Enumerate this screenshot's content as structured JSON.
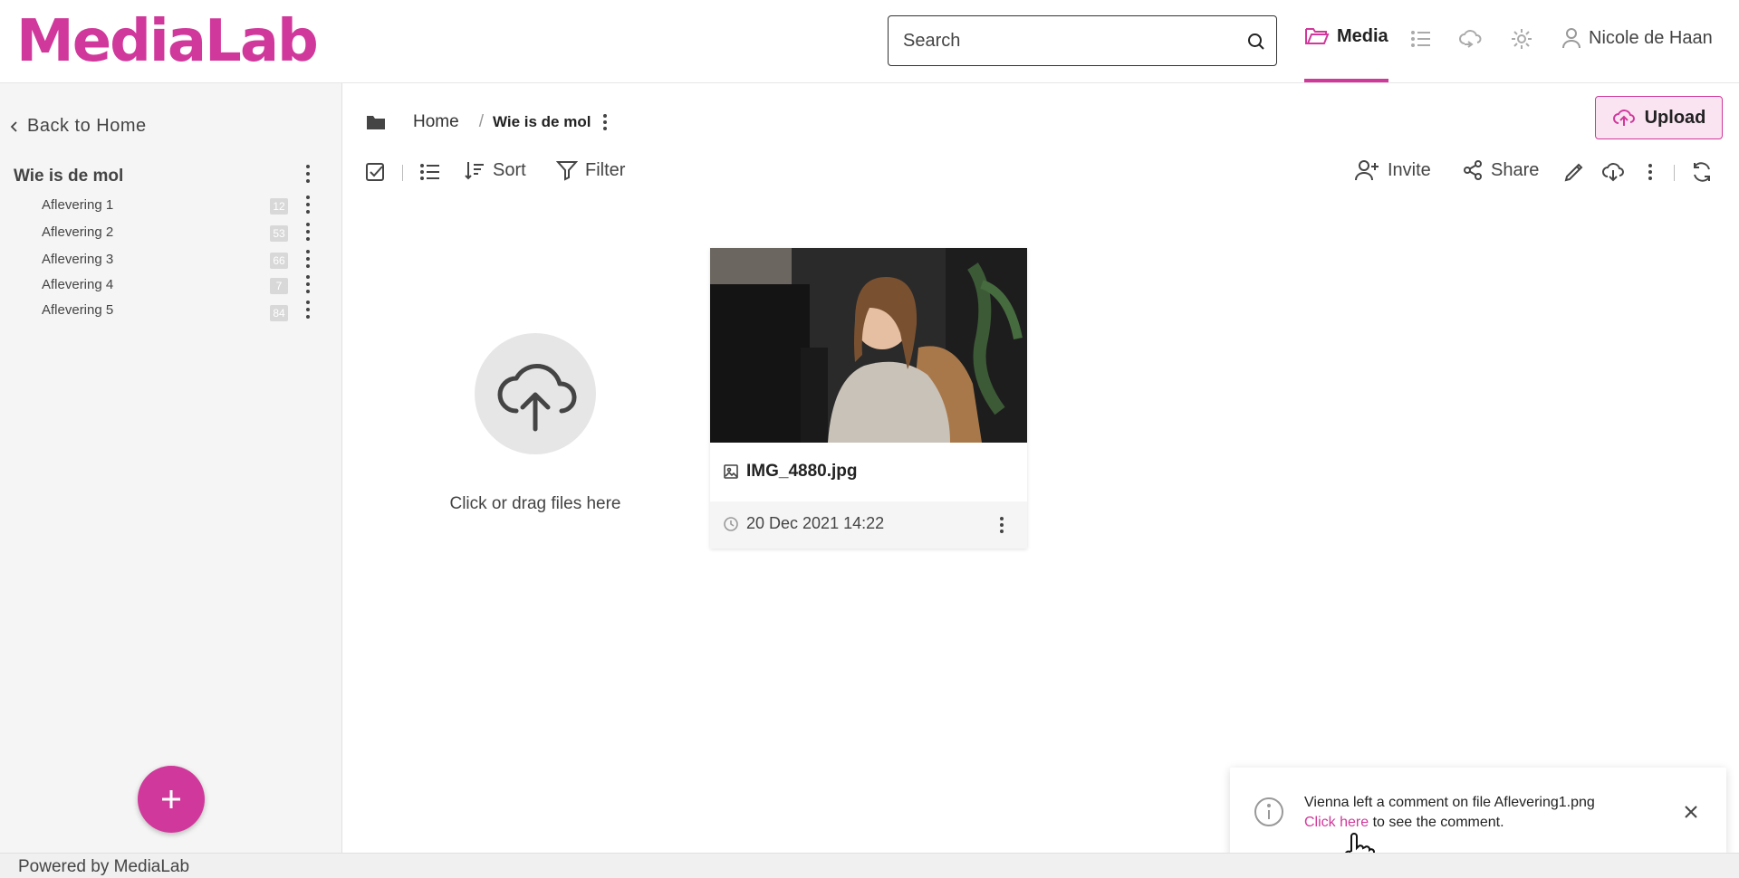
{
  "app": {
    "logo": "MediaLab"
  },
  "header": {
    "search_placeholder": "Search",
    "nav_media_label": "Media",
    "user_name": "Nicole de Haan"
  },
  "sidebar": {
    "back_label": "Back to Home",
    "folder_title": "Wie is de mol",
    "items": [
      {
        "label": "Aflevering 1",
        "count": "12"
      },
      {
        "label": "Aflevering 2",
        "count": "53"
      },
      {
        "label": "Aflevering 3",
        "count": "66"
      },
      {
        "label": "Aflevering 4",
        "count": "7"
      },
      {
        "label": "Aflevering 5",
        "count": "84"
      }
    ]
  },
  "breadcrumb": {
    "home": "Home",
    "separator": "/",
    "current": "Wie is de mol"
  },
  "toolbar": {
    "upload_label": "Upload",
    "sort_label": "Sort",
    "filter_label": "Filter",
    "invite_label": "Invite",
    "share_label": "Share"
  },
  "dropzone": {
    "text": "Click or drag files here"
  },
  "file_card": {
    "name": "IMG_4880.jpg",
    "date": "20 Dec 2021 14:22"
  },
  "toast": {
    "message": "Vienna left a comment on file Aflevering1.png",
    "link_text": "Click here",
    "suffix": " to see the comment."
  },
  "footer": {
    "text": "Powered by MediaLab"
  },
  "colors": {
    "accent": "#d0399b",
    "accent_light": "#fbe4f2",
    "sidebar_bg": "#f5f5f5"
  }
}
